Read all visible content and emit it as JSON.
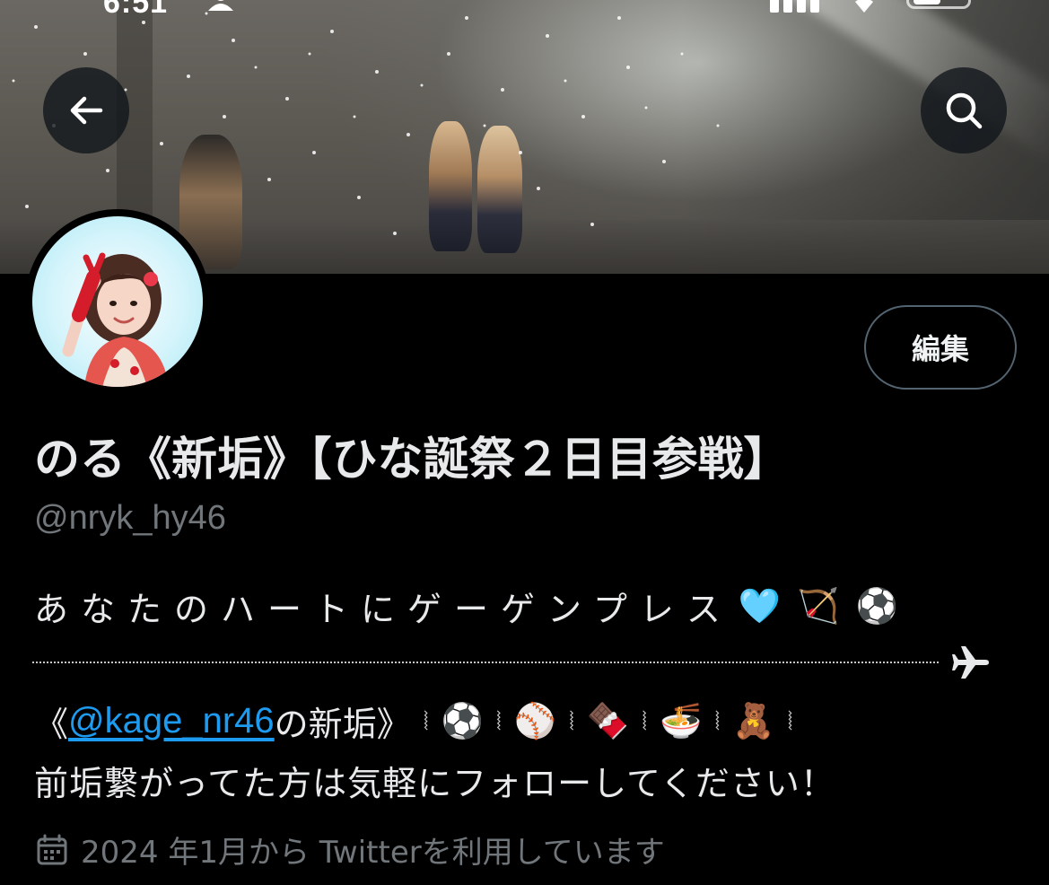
{
  "status_bar": {
    "time": "6:51"
  },
  "header": {
    "back_icon": "arrow-left-icon",
    "search_icon": "search-icon"
  },
  "profile": {
    "edit_label": "編集",
    "display_name": "のる《新垢》【ひな誕祭２日目参戦】",
    "handle": "@nryk_hy46",
    "bio": {
      "line1_text": "あなたのハートにゲーゲンプレス",
      "line1_emojis": [
        "🩵",
        "🏹",
        "⚽"
      ],
      "line2_prefix": "《",
      "line2_mention": "@kage_nr46",
      "line2_suffix": "の新垢》",
      "line2_emojis": [
        "⚽",
        "⚾",
        "🍫",
        "🍜",
        "🧸"
      ],
      "line3": "前垢繋がってた方は気軽にフォローしてください！"
    },
    "joined": "2024 年1月から Twitterを利用しています"
  },
  "colors": {
    "background": "#000000",
    "text_primary": "#e7e9ea",
    "text_secondary": "#71767b",
    "link": "#1d9bf0",
    "button_border": "#536471"
  }
}
